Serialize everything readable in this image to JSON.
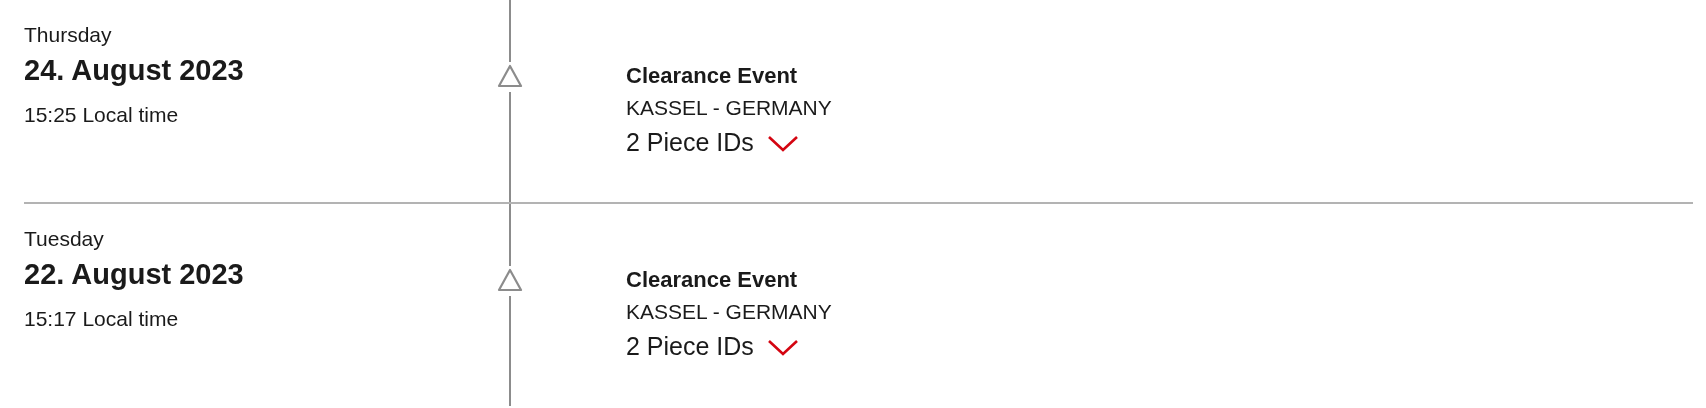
{
  "events": [
    {
      "weekday": "Thursday",
      "date": "24. August 2023",
      "time": "15:25 Local time",
      "title": "Clearance Event",
      "location": "KASSEL - GERMANY",
      "pieces": "2 Piece IDs",
      "expanded": false
    },
    {
      "weekday": "Tuesday",
      "date": "22. August 2023",
      "time": "15:17 Local time",
      "title": "Clearance Event",
      "location": "KASSEL - GERMANY",
      "pieces": "2 Piece IDs",
      "expanded": false
    }
  ]
}
